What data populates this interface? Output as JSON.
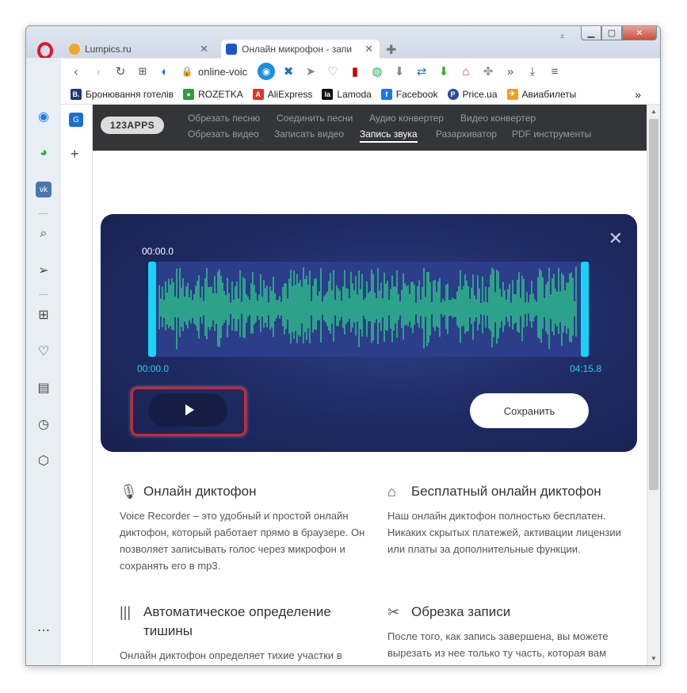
{
  "browser": {
    "tabs": [
      {
        "title": "Lumpics.ru",
        "close": "✕"
      },
      {
        "title": "Онлайн микрофон - запи",
        "close": "✕"
      }
    ],
    "address": "online-voic",
    "bookmarks": [
      {
        "label": "Бронювання готелів",
        "icon": "B.",
        "color": "#1b3a7a"
      },
      {
        "label": "ROZETKA",
        "icon": "●",
        "color": "#2e9e3a"
      },
      {
        "label": "AliExpress",
        "icon": "A",
        "color": "#e43225"
      },
      {
        "label": "Lamoda",
        "icon": "la",
        "color": "#111111"
      },
      {
        "label": "Facebook",
        "icon": "f",
        "color": "#1877f2"
      },
      {
        "label": "Price.ua",
        "icon": "P",
        "color": "#2b4ba0"
      },
      {
        "label": "Авиабилеты",
        "icon": "✈",
        "color": "#f0a020"
      }
    ],
    "bookmarks_more": "»"
  },
  "site": {
    "brand": "123APPS",
    "nav_row1": [
      "Обрезать песню",
      "Соединить песни",
      "Аудио конвертер",
      "Видео конвертер"
    ],
    "nav_row2": [
      "Обрезать видео",
      "Записать видео",
      "Запись звука",
      "Разархиватор",
      "PDF инструменты"
    ],
    "active_nav": "Запись звука"
  },
  "player": {
    "time_top": "00:00.0",
    "time_start": "00:00.0",
    "time_end": "04:15.8",
    "save_label": "Сохранить",
    "wave_color": "#2ee68a",
    "handle_color": "#19d2f5"
  },
  "features": [
    {
      "icon": "mic-icon",
      "title": "Онлайн диктофон",
      "body": "Voice Recorder – это удобный и простой онлайн диктофон, который работает прямо в браузере. Он позволяет записывать голос через микрофон и сохранять его в mp3."
    },
    {
      "icon": "tag-icon",
      "title": "Бесплатный онлайн диктофон",
      "body": "Наш онлайн диктофон полностью бесплатен. Никаких скрытых платежей, активации лицензии или платы за дополнительные функции."
    },
    {
      "icon": "waveform-icon",
      "title": "Автоматическое определение тишины",
      "body": "Онлайн диктофон определяет тихие участки в начале и конце дорожки, и автоматически удаляет их для вашего удобства."
    },
    {
      "icon": "scissors-icon",
      "title": "Обрезка записи",
      "body": "После того, как запись завершена, вы можете вырезать из нее только ту часть, которая вам необходима."
    }
  ]
}
